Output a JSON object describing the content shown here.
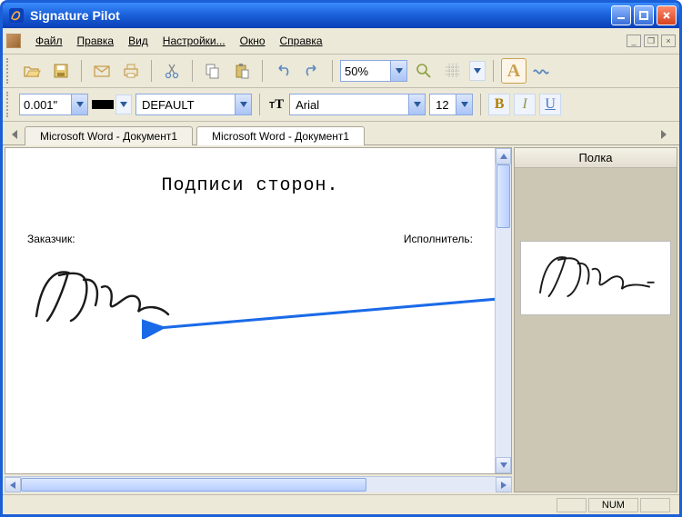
{
  "titlebar": {
    "title": "Signature Pilot"
  },
  "menu": {
    "items": [
      {
        "label": "Файл",
        "u": 0
      },
      {
        "label": "Правка",
        "u": 0
      },
      {
        "label": "Вид",
        "u": 0
      },
      {
        "label": "Настройки...",
        "u": 0
      },
      {
        "label": "Окно",
        "u": 0
      },
      {
        "label": "Справка",
        "u": 0
      }
    ]
  },
  "toolbar1": {
    "zoom": "50%"
  },
  "toolbar2": {
    "size": "0.001\"",
    "stroke_style": "DEFAULT",
    "font_name": "Arial",
    "font_size": "12",
    "bold": "B",
    "italic": "I",
    "underline": "U"
  },
  "tabs": {
    "items": [
      {
        "label": "Microsoft Word - Документ1",
        "active": false
      },
      {
        "label": "Microsoft Word - Документ1",
        "active": true
      }
    ]
  },
  "document": {
    "heading": "Подписи сторон.",
    "left_label": "Заказчик:",
    "right_label": "Исполнитель:"
  },
  "shelf": {
    "title": "Полка"
  },
  "statusbar": {
    "num": "NUM"
  },
  "colors": {
    "accent": "#1a5fd7",
    "toolbar_bg": "#ece9d8"
  }
}
